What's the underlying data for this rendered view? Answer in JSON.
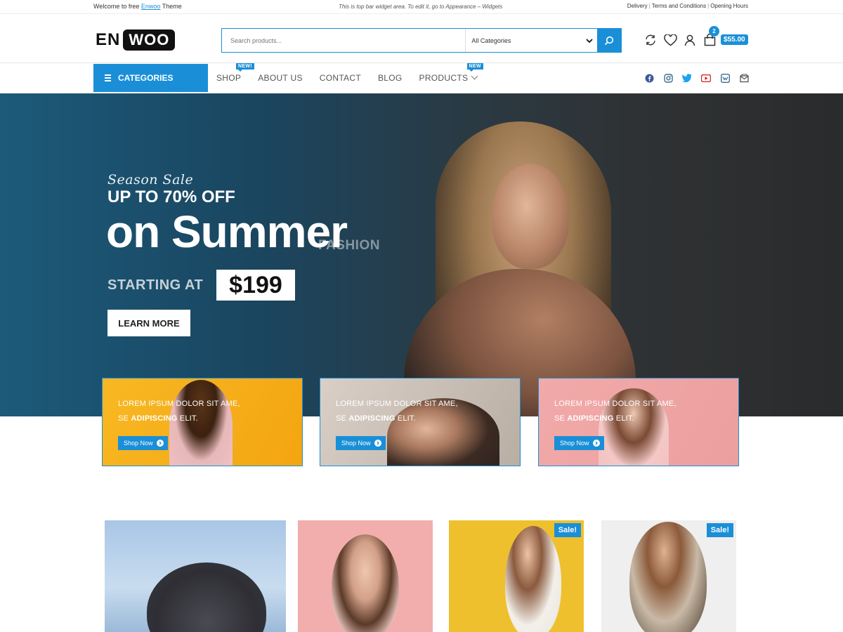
{
  "topbar": {
    "welcome_prefix": "Welcome to free",
    "welcome_link": "Enwoo",
    "welcome_suffix": "Theme",
    "center_text": "This is top bar widget area. To edit it, go to Appearance – Widgets",
    "links": [
      "Delivery",
      "Terms and Conditions",
      "Opening Hours"
    ]
  },
  "header": {
    "logo_part1": "EN",
    "logo_part2": "WOO",
    "search_placeholder": "Search products...",
    "category_select": "All Categories",
    "cart_count": "2",
    "cart_total": "$55.00"
  },
  "nav": {
    "categories_label": "CATEGORIES",
    "items": [
      {
        "label": "SHOP",
        "badge": "NEW!"
      },
      {
        "label": "ABOUT US"
      },
      {
        "label": "CONTACT"
      },
      {
        "label": "BLOG"
      },
      {
        "label": "PRODUCTS",
        "badge": "NEW"
      }
    ],
    "social_icons": [
      "facebook-icon",
      "instagram-icon",
      "twitter-icon",
      "youtube-icon",
      "vk-icon",
      "email-icon"
    ]
  },
  "hero": {
    "script_line": "Season Sale",
    "headline_small": "UP TO 70% OFF",
    "headline_big": "on Summer",
    "overlay_word": "FASHION",
    "starting_label": "STARTING AT",
    "price": "$199",
    "cta": "LEARN MORE"
  },
  "promos": [
    {
      "line1": "LOREM IPSUM DOLOR SIT AME,",
      "line2_prefix": "SE",
      "line2_bold": "ADIPISCING",
      "line2_suffix": "ELIT.",
      "cta": "Shop Now",
      "bg": "#f8b823"
    },
    {
      "line1": "LOREM IPSUM DOLOR SIT AME,",
      "line2_prefix": "SE",
      "line2_bold": "ADIPISCING",
      "line2_suffix": "ELIT.",
      "cta": "Shop Now",
      "bg": "#d9cfc6"
    },
    {
      "line1": "LOREM IPSUM DOLOR SIT AME,",
      "line2_prefix": "SE",
      "line2_bold": "ADIPISCING",
      "line2_suffix": "ELIT.",
      "cta": "Shop Now",
      "bg": "#f1aaa9"
    }
  ],
  "products": [
    {
      "sale": ""
    },
    {
      "sale": ""
    },
    {
      "sale": "Sale!"
    },
    {
      "sale": "Sale!"
    }
  ],
  "colors": {
    "accent": "#1a8fd8",
    "text": "#333333"
  }
}
